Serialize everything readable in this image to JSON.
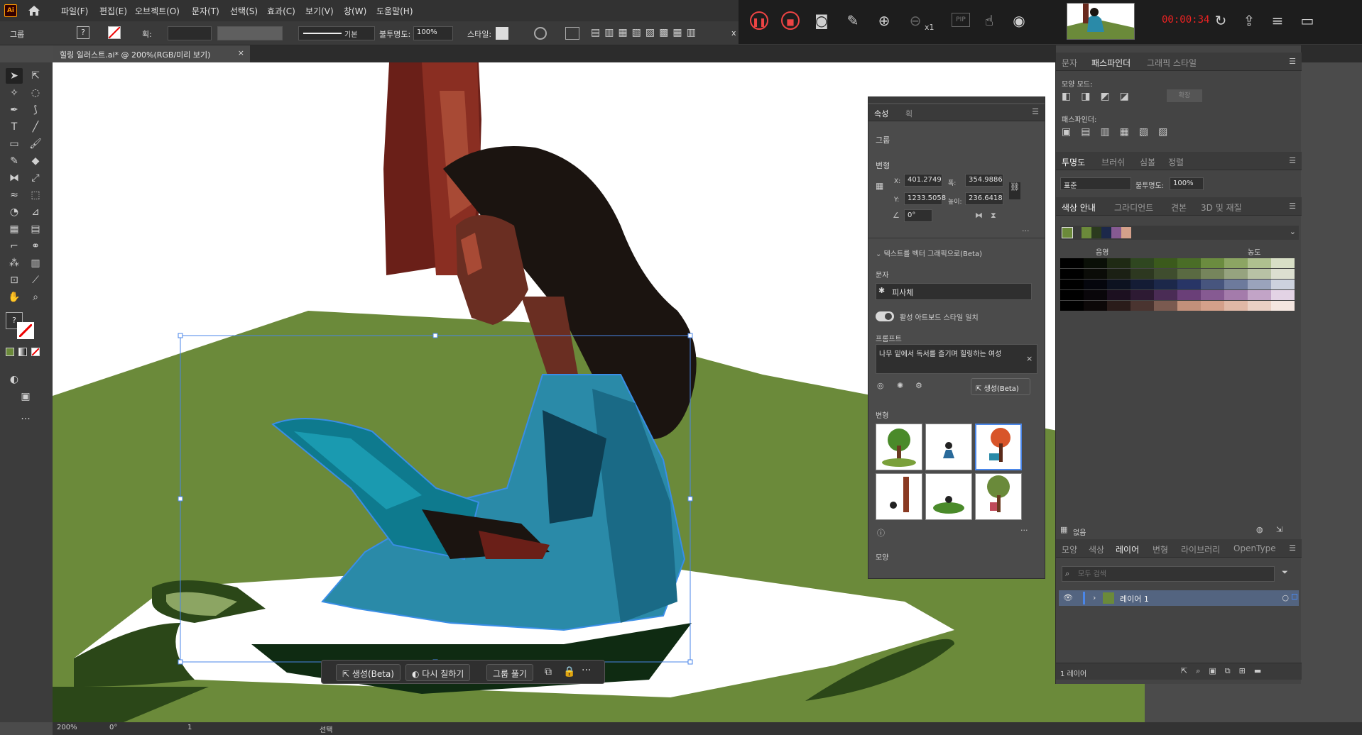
{
  "menubar": {
    "logo": "Ai",
    "items": [
      "파일(F)",
      "편집(E)",
      "오브젝트(O)",
      "문자(T)",
      "선택(S)",
      "효과(C)",
      "보기(V)",
      "창(W)",
      "도움말(H)"
    ]
  },
  "control": {
    "selection_label": "그룹",
    "stroke_style": "기본",
    "opacity_label": "불투명도:",
    "opacity_value": "100%",
    "style_label": "스타일:",
    "x_marker": "x"
  },
  "recorder": {
    "zoom_level": "x1",
    "pip_label": "PIP",
    "timer": "00:00:34"
  },
  "document": {
    "tab_title": "힐링 일러스트.ai* @ 200%(RGB/미리 보기)"
  },
  "properties": {
    "tabs": [
      "속성",
      "획"
    ],
    "selection_type": "그룹",
    "transform_heading": "변형",
    "x_label": "X:",
    "x_value": "401.2749",
    "y_label": "Y:",
    "y_value": "1233.5058",
    "w_label": "폭:",
    "w_value": "354.9886",
    "h_label": "높이:",
    "h_value": "236.6418",
    "angle_value": "0°",
    "text_to_vector_heading": "텍스트를 벡터 그래픽으로(Beta)",
    "type_label": "문자",
    "type_value": "피사체",
    "match_style_label": "활성 아트보드 스타일 일치",
    "prompt_label": "프롬프트",
    "prompt_value": "나무 밑에서 독서를 즐기며 힐링하는 여성",
    "generate_label": "생성(Beta)",
    "variations_heading": "변형",
    "appearance_heading": "모양"
  },
  "dock": {
    "pathfinder_tabs": [
      "문자",
      "패스파인더",
      "그래픽 스타일"
    ],
    "shape_modes_label": "모양 모드:",
    "expand_label": "확장",
    "pathfinders_label": "패스파인더:",
    "transparency_tabs": [
      "투명도",
      "브러쉬",
      "심볼",
      "정렬"
    ],
    "blend_mode": "표준",
    "opacity_label": "불투명도:",
    "opacity_value": "100%",
    "guide_tabs": [
      "색상 안내",
      "그라디언트",
      "견본",
      "3D 및 재질"
    ],
    "shade_label": "음영",
    "vivid_label": "농도",
    "none_label": "없음",
    "layer_tabs": [
      "모양",
      "색상",
      "레이어",
      "변형",
      "라이브러리",
      "OpenType"
    ],
    "search_placeholder": "모두 검색",
    "layer_name": "레이어 1",
    "layer_count": "1 레이어"
  },
  "guide_colors": [
    [
      "#000000",
      "#0a0f07",
      "#1f2a14",
      "#2f4720",
      "#3b5a1c",
      "#4a6d27",
      "#6b8c3f",
      "#8ca563",
      "#afc08f",
      "#d8dfc6"
    ],
    [
      "#000000",
      "#0b0c08",
      "#1b2014",
      "#2d3820",
      "#3f4d2e",
      "#5a6a42",
      "#76855c",
      "#96a37f",
      "#b8c2a5",
      "#dcdfd0"
    ],
    [
      "#000000",
      "#05060d",
      "#0d1220",
      "#141c35",
      "#1c284a",
      "#283566",
      "#47557e",
      "#6d7a9c",
      "#9aa3bc",
      "#cdd2de"
    ],
    [
      "#000000",
      "#09060a",
      "#1c1020",
      "#2d1a33",
      "#4a2c55",
      "#6a3f78",
      "#865a92",
      "#a47bab",
      "#c2a4c7",
      "#e3d3e5"
    ],
    [
      "#000000",
      "#0c0808",
      "#2a1c1a",
      "#4a3430",
      "#7a5a50",
      "#c2907a",
      "#d4a08a",
      "#e0b8a6",
      "#ead0c4",
      "#f4e6e0"
    ]
  ],
  "context_bar": {
    "generate": "생성(Beta)",
    "recolor": "다시 칠하기",
    "ungroup": "그룹 풀기"
  },
  "status": {
    "zoom": "200%",
    "angle": "0°",
    "artboard": "1",
    "tool": "선택"
  }
}
